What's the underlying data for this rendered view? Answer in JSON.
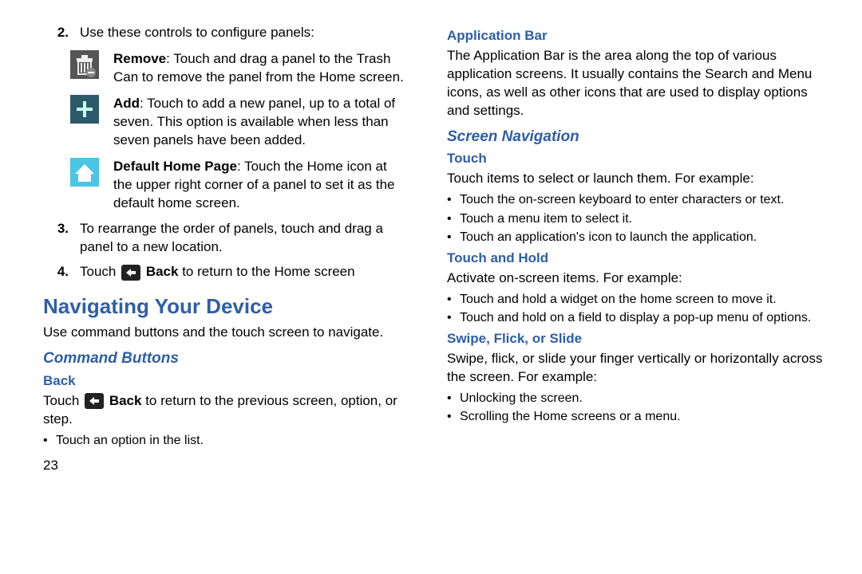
{
  "left": {
    "item2_num": "2.",
    "item2_text": "Use these controls to configure panels:",
    "remove_label": "Remove",
    "remove_text": ": Touch and drag a panel to the Trash Can to remove the panel from the Home screen.",
    "add_label": "Add",
    "add_text": ": Touch to add a new panel, up to a total of seven. This option is available when less than seven panels have been added.",
    "default_label": "Default Home Page",
    "default_text": ": Touch the Home icon at the upper right corner of a panel to set it as the default home screen.",
    "item3_num": "3.",
    "item3_text": "To rearrange the order of panels, touch and drag a panel to a new location.",
    "item4_num": "4.",
    "item4_pre": "Touch ",
    "item4_backlabel": " Back",
    "item4_post": " to return to the Home screen",
    "h1": "Navigating Your Device",
    "nav_intro": "Use command buttons and the touch screen to navigate.",
    "h2_cmd": "Command Buttons",
    "h3_back": "Back",
    "back_pre": "Touch ",
    "back_label": " Back",
    "back_post": " to return to the previous screen, option, or step.",
    "bullet_option": "Touch an option in the list.",
    "pagenum": "23"
  },
  "right": {
    "h3_appbar": "Application Bar",
    "appbar_text": "The Application Bar is the area along the top of various application screens. It usually contains the Search and Menu icons, as well as other icons that are used to display options and settings.",
    "h2_screen": "Screen Navigation",
    "h3_touch": "Touch",
    "touch_intro": "Touch items to select or launch them. For example:",
    "touch_b1": "Touch the on-screen keyboard to enter characters or text.",
    "touch_b2": "Touch a menu item to select it.",
    "touch_b3": "Touch an application's icon to launch the application.",
    "h3_th": "Touch and Hold",
    "th_intro": "Activate on-screen items. For example:",
    "th_b1": "Touch and hold a widget on the home screen to move it.",
    "th_b2": "Touch and hold on a field to display a pop-up menu of options.",
    "h3_swipe": "Swipe, Flick, or Slide",
    "swipe_intro": "Swipe, flick, or slide your finger vertically or horizontally across the screen. For example:",
    "swipe_b1": "Unlocking the screen.",
    "swipe_b2": "Scrolling the Home screens or a menu."
  }
}
